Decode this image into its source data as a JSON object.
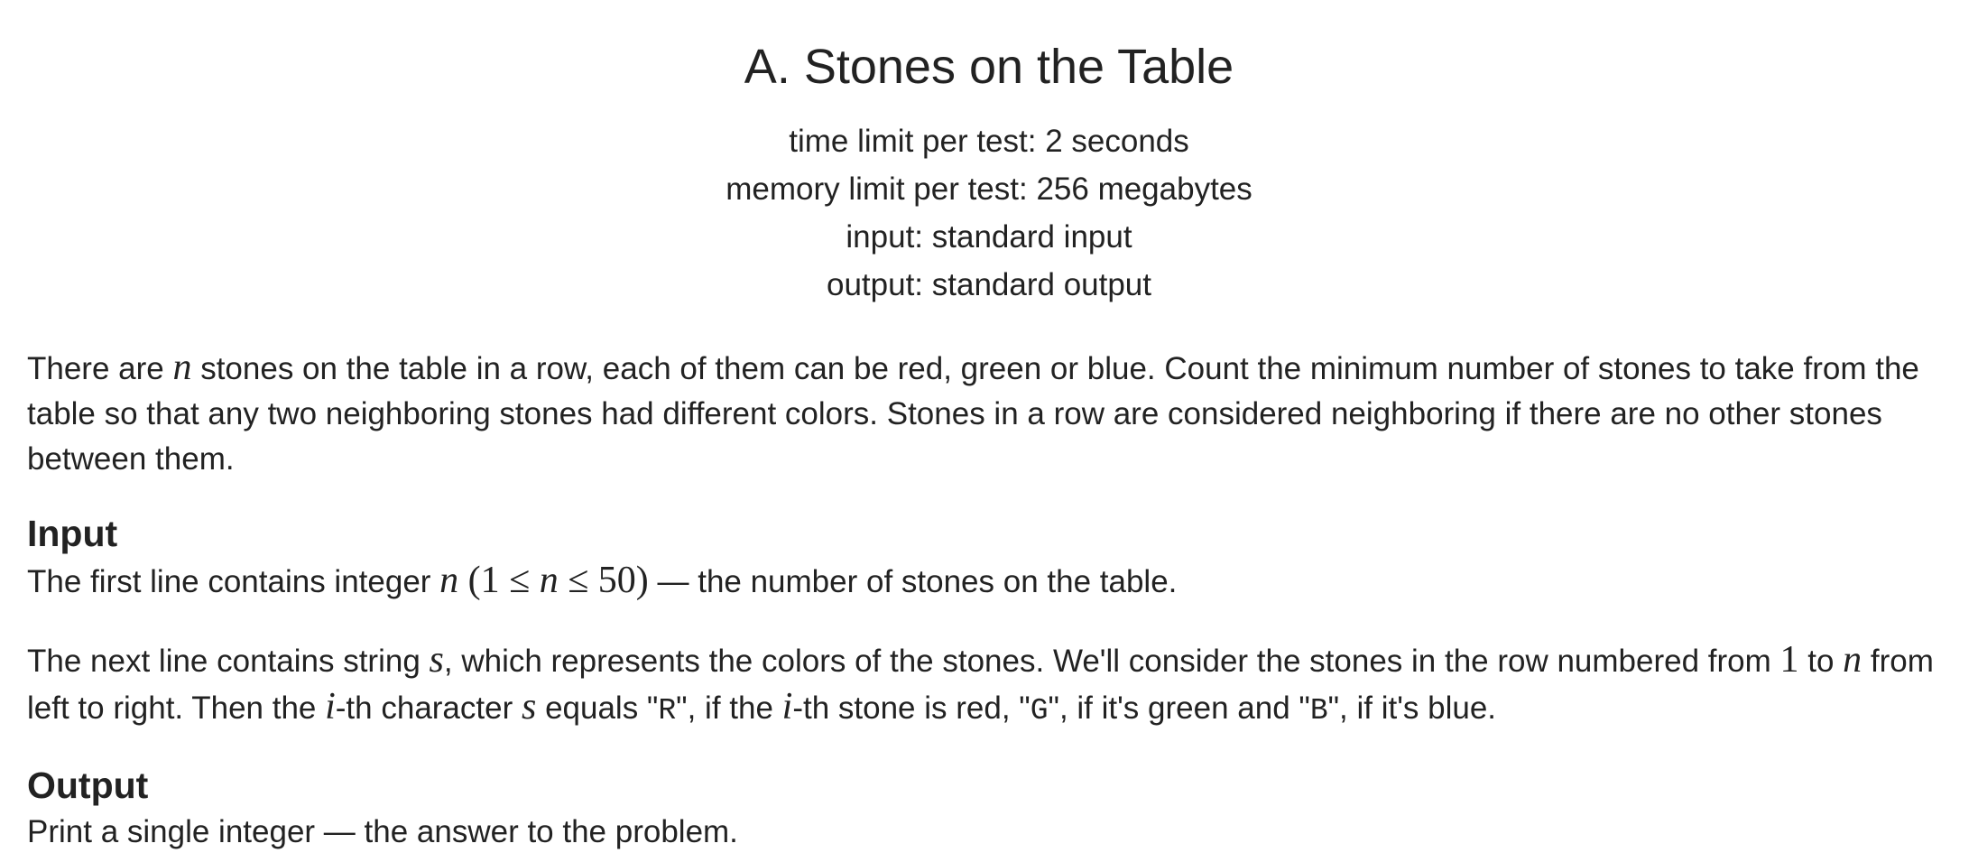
{
  "problem": {
    "title": "A. Stones on the Table",
    "time_limit": "time limit per test: 2 seconds",
    "memory_limit": "memory limit per test: 256 megabytes",
    "input_file": "input: standard input",
    "output_file": "output: standard output"
  },
  "statement": {
    "p1_a": "There are ",
    "var_n": "n",
    "p1_b": " stones on the table in a row, each of them can be red, green or blue. Count the minimum number of stones to take from the table so that any two neighboring stones had different colors. Stones in a row are considered neighboring if there are no other stones between them."
  },
  "input_section": {
    "heading": "Input",
    "line1_a": "The first line contains integer ",
    "line1_n": "n",
    "line1_paren_open": " (1 ≤ ",
    "line1_n2": "n",
    "line1_paren_close": " ≤ 50)",
    "line1_b": " — the number of stones on the table.",
    "line2_a": "The next line contains string ",
    "line2_s": "s",
    "line2_b": ", which represents the colors of the stones. We'll consider the stones in the row numbered from ",
    "line2_one": "1",
    "line2_to": " to ",
    "line2_n": "n",
    "line2_c": " from left to right. Then the ",
    "line2_i": "i",
    "line2_d": "-th character ",
    "line2_s2": "s",
    "line2_e": " equals \"",
    "char_R": "R",
    "line2_f": "\", if the ",
    "line2_i2": "i",
    "line2_g": "-th stone is red, \"",
    "char_G": "G",
    "line2_h": "\", if it's green and \"",
    "char_B": "B",
    "line2_j": "\", if it's blue."
  },
  "output_section": {
    "heading": "Output",
    "text": "Print a single integer — the answer to the problem."
  }
}
